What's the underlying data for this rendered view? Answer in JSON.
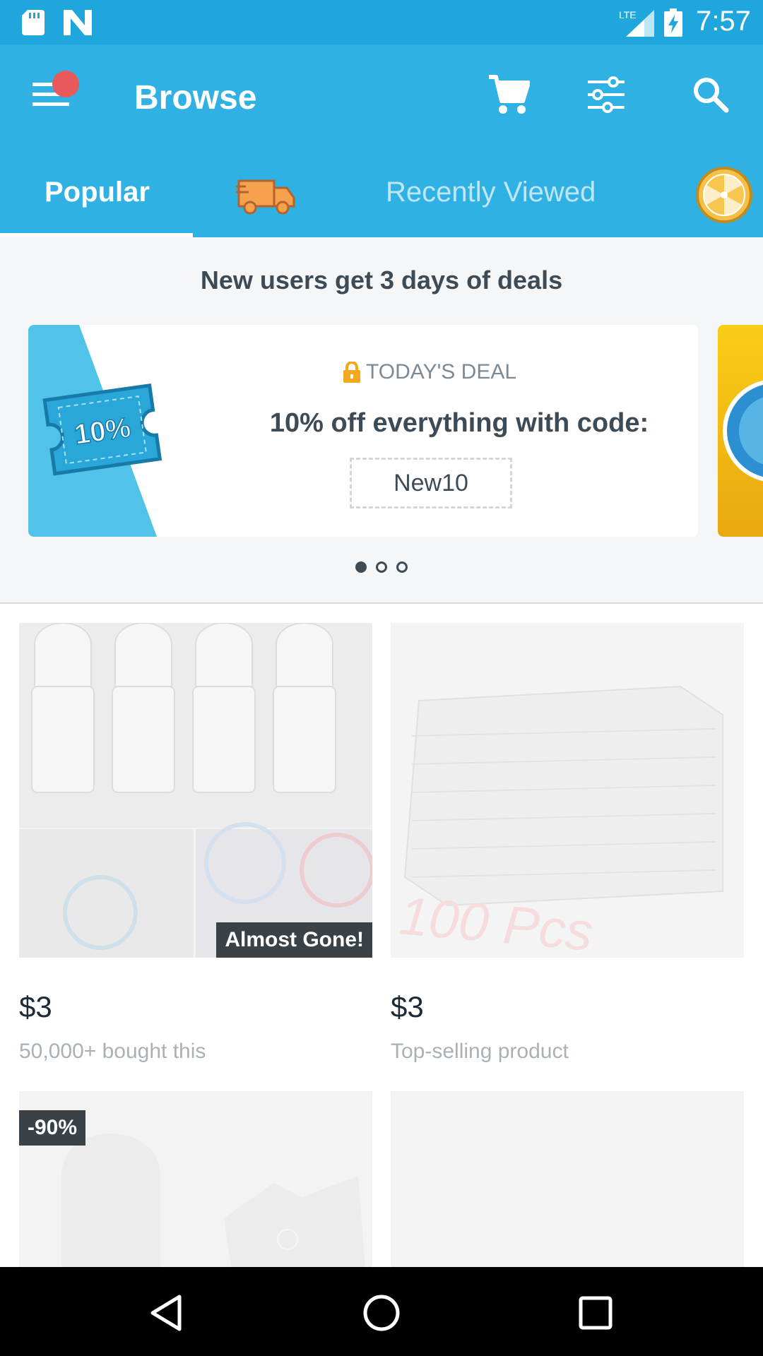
{
  "status_bar": {
    "time": "7:57",
    "network": "LTE"
  },
  "app_bar": {
    "title": "Browse"
  },
  "tabs": [
    {
      "label": "Popular",
      "active": true
    },
    {
      "label": "Recently Viewed",
      "active": false
    }
  ],
  "promo": {
    "heading": "New users get 3 days of deals",
    "deal_label": "TODAY'S DEAL",
    "deal_text": "10% off everything with code:",
    "code": "New10",
    "ticket_text": "10%",
    "page_count": 3,
    "active_page": 1
  },
  "products": [
    {
      "price": "$3",
      "subtitle": "50,000+ bought this",
      "badge": "Almost Gone!"
    },
    {
      "price": "$3",
      "subtitle": "Top-selling product",
      "image_text": "100 Pcs"
    },
    {
      "badge": "-90%"
    },
    {}
  ],
  "colors": {
    "primary": "#2fb1e4",
    "status": "#1fa6dd",
    "notification": "#e85a5a",
    "text": "#3d4b57"
  }
}
